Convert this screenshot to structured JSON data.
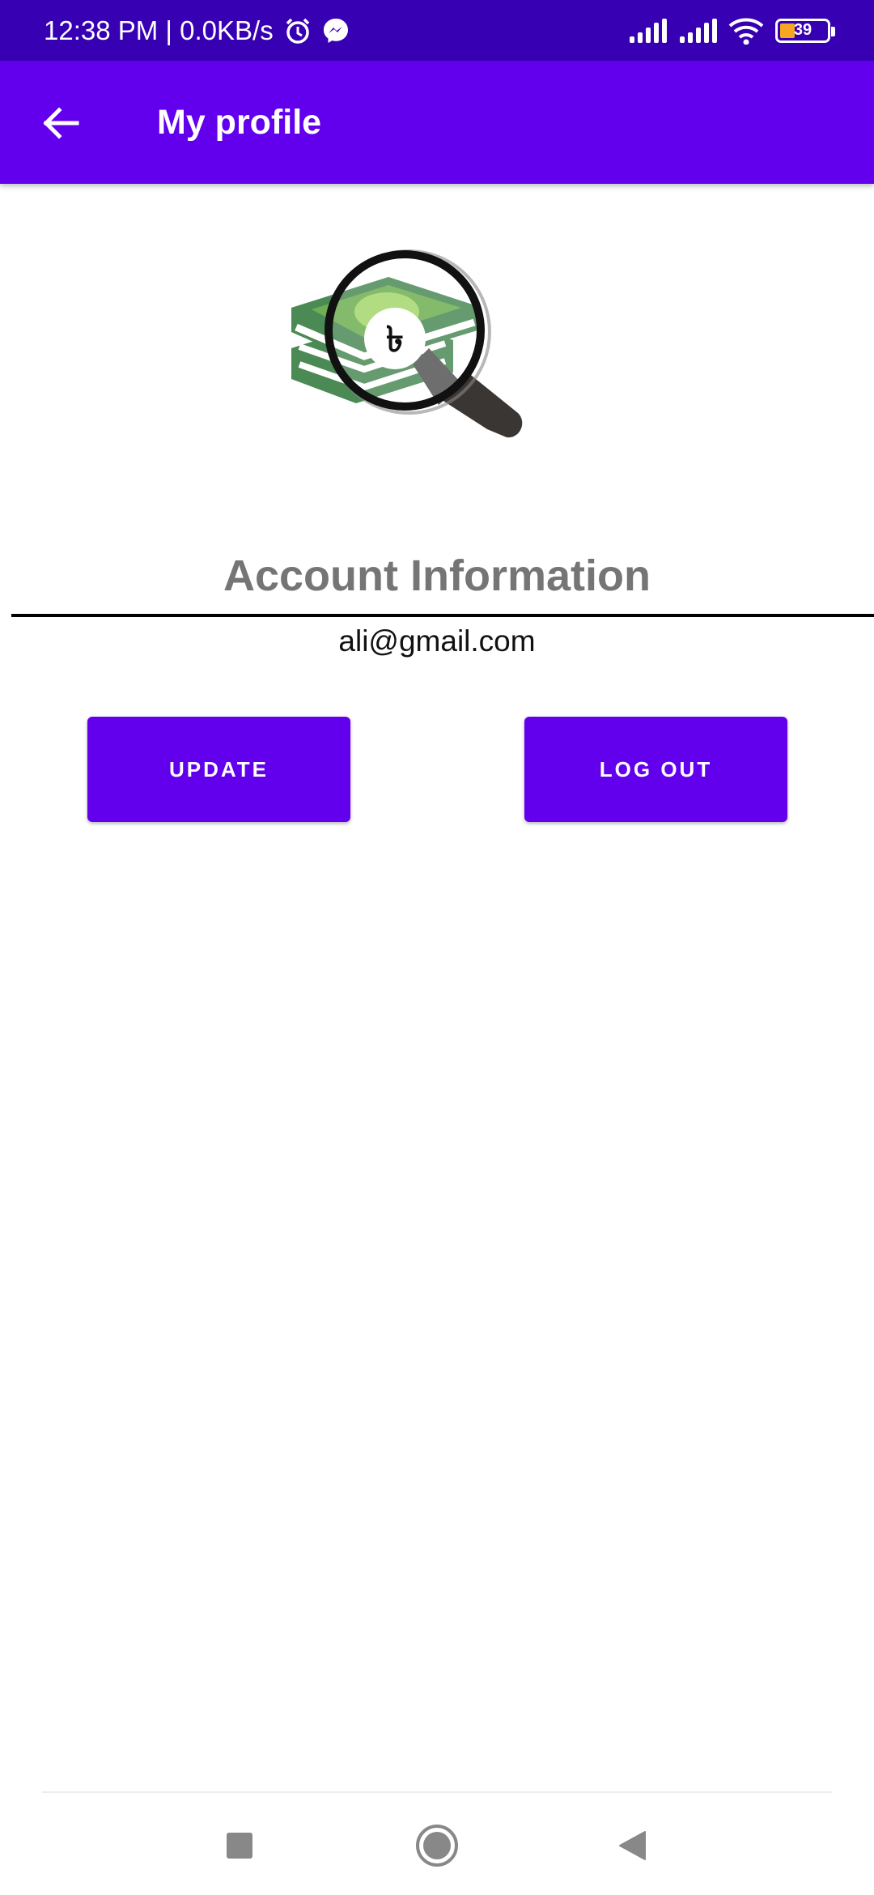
{
  "status_bar": {
    "time_info": "12:38 PM | 0.0KB/s",
    "battery": "39",
    "icons": [
      "alarm-icon",
      "messenger-icon",
      "signal-icon",
      "signal-icon",
      "wifi-icon",
      "battery-icon"
    ]
  },
  "app_bar": {
    "title": "My profile",
    "back_icon": "arrow-left-icon"
  },
  "illustration": {
    "icon": "money-magnifier-icon",
    "symbol": "৳"
  },
  "account": {
    "section_title": "Account Information",
    "email": "ali@gmail.com"
  },
  "actions": {
    "update_label": "UPDATE",
    "logout_label": "LOG OUT"
  },
  "navigation": {
    "icons": [
      "recent-apps-icon",
      "home-icon",
      "back-icon"
    ]
  },
  "colors": {
    "status_bar": "#3700b3",
    "app_bar": "#6200ee",
    "button": "#6200ee",
    "title_text": "#757575"
  }
}
